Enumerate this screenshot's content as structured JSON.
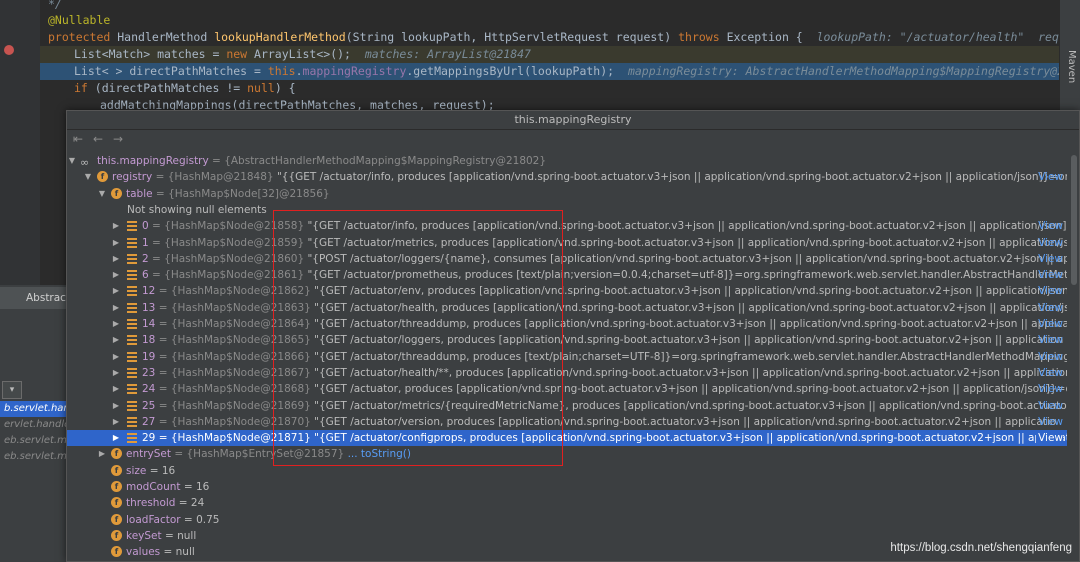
{
  "editor": {
    "lines": [
      {
        "parts": [
          [
            "hint",
            "*/"
          ]
        ]
      },
      {
        "parts": [
          [
            "ann",
            "@Nullable"
          ]
        ]
      },
      {
        "parts": [
          [
            "kw",
            "protected "
          ],
          [
            "",
            "HandlerMethod "
          ],
          [
            "fn",
            "lookupHandlerMethod"
          ],
          [
            "",
            "(String lookupPath, HttpServletRequest request) "
          ],
          [
            "kw",
            "throws "
          ],
          [
            "",
            "Exception {  "
          ],
          [
            "hint",
            "lookupPath: \"/actuator/health\"  request: Req"
          ]
        ]
      },
      {
        "parts": [
          [
            "",
            "List<Match> matches = "
          ],
          [
            "kw",
            "new "
          ],
          [
            "",
            "ArrayList<>();  "
          ],
          [
            "hint",
            "matches: ArrayList@21847"
          ]
        ]
      },
      {
        "parts": [
          [
            "",
            "List< > directPathMatches = "
          ],
          [
            "thisk",
            "this"
          ],
          [
            "",
            "."
          ],
          [
            "fld",
            "mappingRegistry"
          ],
          [
            "",
            ".getMappingsByUrl(lookupPath);  "
          ],
          [
            "hint",
            "mappingRegistry: AbstractHandlerMethodMapping$MappingRegistry@21802  lo"
          ]
        ]
      },
      {
        "parts": [
          [
            "kw",
            "if "
          ],
          [
            "",
            "(directPathMatches != "
          ],
          [
            "kw",
            "null"
          ],
          [
            "",
            ") {"
          ]
        ]
      },
      {
        "parts": [
          [
            "",
            "addMatchingMappings(directPathMatches, matches, request);"
          ]
        ]
      }
    ],
    "right_strip_label": "Maven",
    "left_tab": "Abstract",
    "left_rows": [
      "b.servlet.han",
      "ervlet.handler",
      "eb.servlet.mvc",
      "eb.servlet.mvc"
    ]
  },
  "popup": {
    "title": "this.mappingRegistry",
    "back_icon": "back-arrow-icon",
    "forward_icon": "forward-arrow-icon",
    "root": {
      "name": "this.mappingRegistry",
      "value": " = {AbstractHandlerMethodMapping$MappingRegistry@21802}"
    },
    "registry": {
      "name": "registry",
      "ref": " = {HashMap@21848} ",
      "value": "\"{{GET /actuator/info, produces [application/vnd.spring-boot.actuator.v3+json || application/vnd.spring-boot.actuator.v2+json || application/json]}=org.",
      "view": "View"
    },
    "table": {
      "name": "table",
      "ref": " = {HashMap$Node[32]@21856}"
    },
    "null_note": "Not showing null elements",
    "nodes": [
      {
        "idx": "0",
        "ref": " = {HashMap$Node@21858} ",
        "value": "\"{GET /actuator/info, produces [application/vnd.spring-boot.actuator.v3+json || application/vnd.spring-boot.actuator.v2+json || application/json]}",
        "view": "View"
      },
      {
        "idx": "1",
        "ref": " = {HashMap$Node@21859} ",
        "value": "\"{GET /actuator/metrics, produces [application/vnd.spring-boot.actuator.v3+json || application/vnd.spring-boot.actuator.v2+json || application/jsc",
        "view": "View"
      },
      {
        "idx": "2",
        "ref": " = {HashMap$Node@21860} ",
        "value": "\"{POST /actuator/loggers/{name}, consumes [application/vnd.spring-boot.actuator.v3+json || application/vnd.spring-boot.actuator.v2+json || app",
        "view": "View"
      },
      {
        "idx": "6",
        "ref": " = {HashMap$Node@21861} ",
        "value": "\"{GET /actuator/prometheus, produces [text/plain;version=0.0.4;charset=utf-8]}=org.springframework.web.servlet.handler.AbstractHandlerMetho",
        "view": "View"
      },
      {
        "idx": "12",
        "ref": " = {HashMap$Node@21862} ",
        "value": "\"{GET /actuator/env, produces [application/vnd.spring-boot.actuator.v3+json || application/vnd.spring-boot.actuator.v2+json || application/json]",
        "view": "View"
      },
      {
        "idx": "13",
        "ref": " = {HashMap$Node@21863} ",
        "value": "\"{GET /actuator/health, produces [application/vnd.spring-boot.actuator.v3+json || application/vnd.spring-boot.actuator.v2+json || application/js",
        "view": "View"
      },
      {
        "idx": "14",
        "ref": " = {HashMap$Node@21864} ",
        "value": "\"{GET /actuator/threaddump, produces [application/vnd.spring-boot.actuator.v3+json || application/vnd.spring-boot.actuator.v2+json || applicat",
        "view": "View"
      },
      {
        "idx": "18",
        "ref": " = {HashMap$Node@21865} ",
        "value": "\"{GET /actuator/loggers, produces [application/vnd.spring-boot.actuator.v3+json || application/vnd.spring-boot.actuator.v2+json || application",
        "view": "View"
      },
      {
        "idx": "19",
        "ref": " = {HashMap$Node@21866} ",
        "value": "\"{GET /actuator/threaddump, produces [text/plain;charset=UTF-8]}=org.springframework.web.servlet.handler.AbstractHandlerMethodMapping$",
        "view": "View"
      },
      {
        "idx": "23",
        "ref": " = {HashMap$Node@21867} ",
        "value": "\"{GET /actuator/health/**, produces [application/vnd.spring-boot.actuator.v3+json || application/vnd.spring-boot.actuator.v2+json || application",
        "view": "View"
      },
      {
        "idx": "24",
        "ref": " = {HashMap$Node@21868} ",
        "value": "\"{GET /actuator, produces [application/vnd.spring-boot.actuator.v3+json || application/vnd.spring-boot.actuator.v2+json || application/json]}=o",
        "view": "View"
      },
      {
        "idx": "25",
        "ref": " = {HashMap$Node@21869} ",
        "value": "\"{GET /actuator/metrics/{requiredMetricName}, produces [application/vnd.spring-boot.actuator.v3+json || application/vnd.spring-boot.actuator.",
        "view": "View"
      },
      {
        "idx": "27",
        "ref": " = {HashMap$Node@21870} ",
        "value": "\"{GET /actuator/version, produces [application/vnd.spring-boot.actuator.v3+json || application/vnd.spring-boot.actuator.v2+json || applicatio",
        "view": "View"
      },
      {
        "idx": "29",
        "ref": " = {HashMap$Node@21871} ",
        "value": "\"{GET /actuator/configprops, produces [application/vnd.spring-boot.actuator.v3+json || application/vnd.spring-boot.actuator.v2+json || applicat",
        "view": "View",
        "selected": true
      }
    ],
    "entryset": {
      "name": "entrySet",
      "ref": " = {HashMap$EntrySet@21857} ",
      "link": "... toString()"
    },
    "fields": [
      {
        "name": "size",
        "value": " = 16"
      },
      {
        "name": "modCount",
        "value": " = 16"
      },
      {
        "name": "threshold",
        "value": " = 24"
      },
      {
        "name": "loadFactor",
        "value": " = 0.75"
      },
      {
        "name": "keySet",
        "value": " = null"
      },
      {
        "name": "values",
        "value": " = null"
      }
    ]
  },
  "watermark": "https://blog.csdn.net/shengqianfeng",
  "colors": {
    "selection": "#2f65ca",
    "highlight": "#2d5275",
    "annotation_box": "#e02020",
    "link": "#589df6"
  }
}
